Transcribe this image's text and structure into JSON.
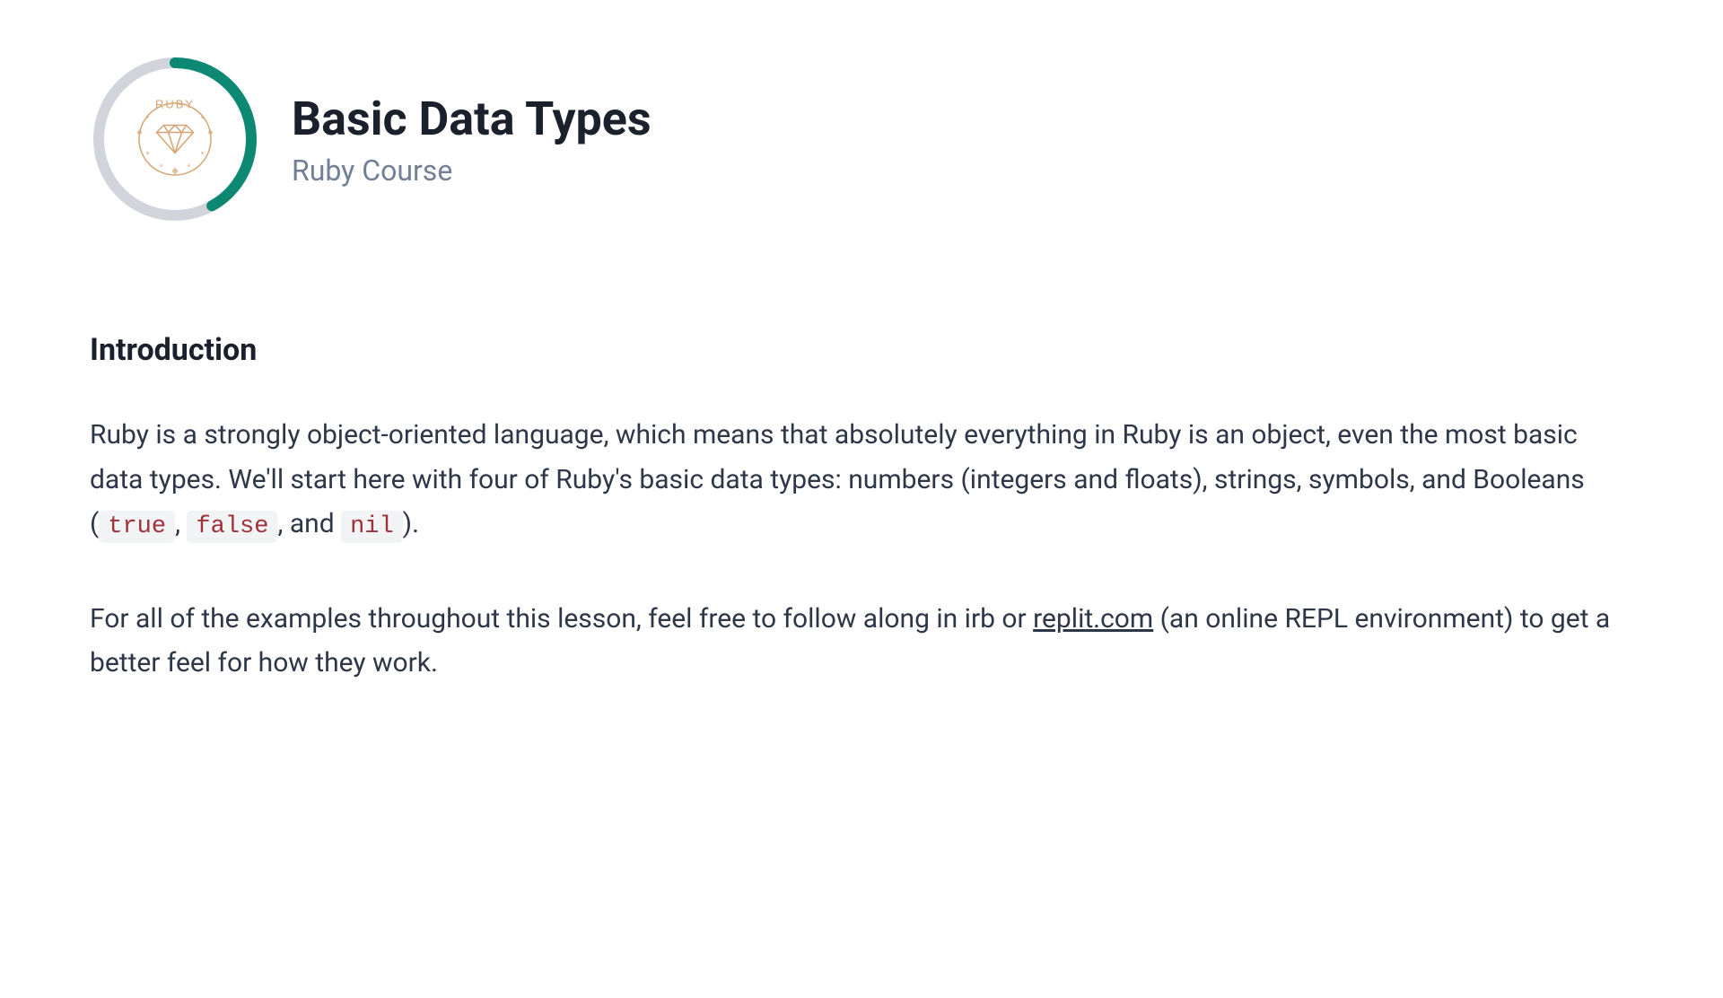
{
  "header": {
    "title": "Basic Data Types",
    "subtitle": "Ruby Course",
    "badge_label": "RUBY",
    "progress_percent": 42
  },
  "section": {
    "heading": "Introduction",
    "paragraph1_parts": {
      "p1": "Ruby is a strongly object-oriented language, which means that absolutely everything in Ruby is an object, even the most basic data types. We'll start here with four of Ruby's basic data types: numbers (integers and floats), strings, symbols, and Booleans (",
      "code1": "true",
      "sep1": ", ",
      "code2": "false",
      "sep2": ", and ",
      "code3": "nil",
      "p2": ")."
    },
    "paragraph2_parts": {
      "p1": "For all of the examples throughout this lesson, feel free to follow along in irb or ",
      "link_text": "replit.com",
      "p2": " (an online REPL environment) to get a better feel for how they work."
    }
  }
}
